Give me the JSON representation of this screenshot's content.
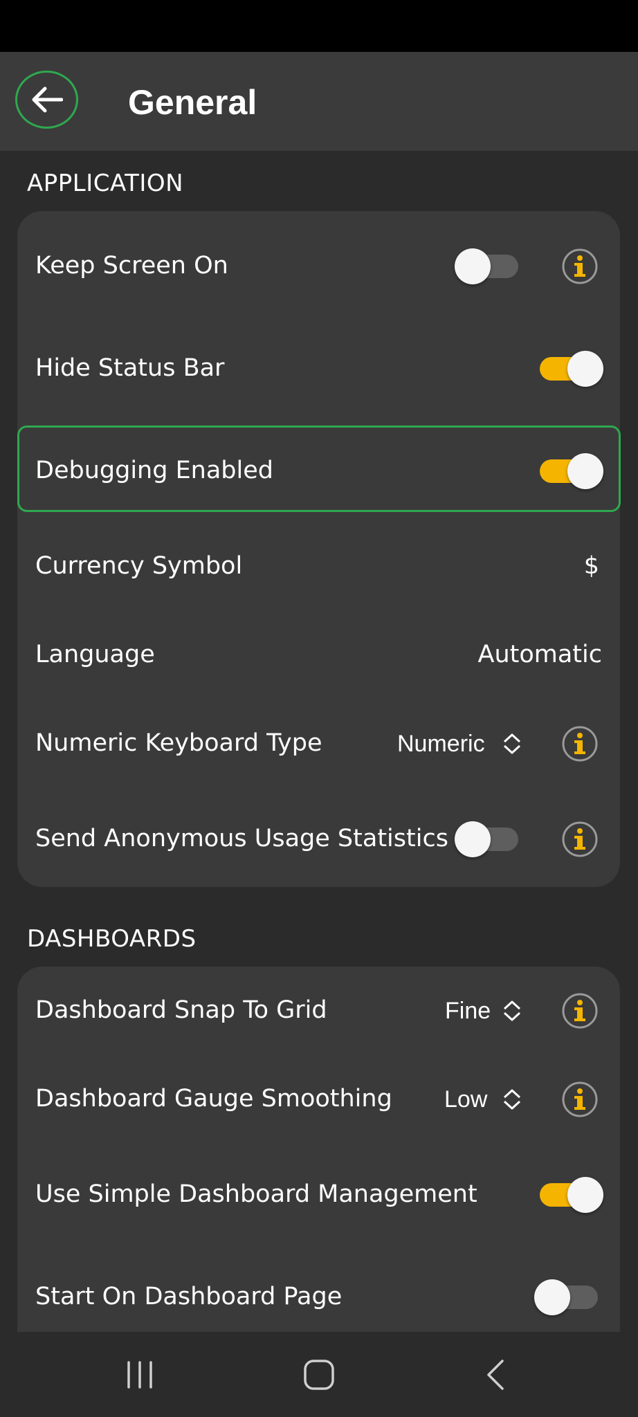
{
  "header": {
    "title": "General"
  },
  "sections": {
    "application": {
      "title": "APPLICATION",
      "rows": {
        "keep_screen_on": {
          "label": "Keep Screen On",
          "toggle": "off"
        },
        "hide_status_bar": {
          "label": "Hide Status Bar",
          "toggle": "on"
        },
        "debugging_enabled": {
          "label": "Debugging Enabled",
          "toggle": "on"
        },
        "currency_symbol": {
          "label": "Currency Symbol",
          "value": "$"
        },
        "language": {
          "label": "Language",
          "value": "Automatic"
        },
        "numeric_keyboard_type": {
          "label": "Numeric Keyboard Type",
          "value": "Numeric"
        },
        "send_usage_stats": {
          "label": "Send Anonymous Usage Statistics",
          "toggle": "off"
        }
      }
    },
    "dashboards": {
      "title": "DASHBOARDS",
      "rows": {
        "snap_to_grid": {
          "label": "Dashboard Snap To Grid",
          "value": "Fine"
        },
        "gauge_smoothing": {
          "label": "Dashboard Gauge Smoothing",
          "value": "Low"
        },
        "simple_management": {
          "label": "Use Simple Dashboard Management",
          "toggle": "on"
        },
        "start_on_dashboard": {
          "label": "Start On Dashboard Page",
          "toggle": "off"
        }
      }
    }
  },
  "colors": {
    "accent": "#f4b400",
    "highlight": "#2fa84f",
    "card": "#3a3a3a",
    "background": "#2b2b2b"
  },
  "icons": {
    "back": "arrow-left-icon",
    "info": "info-icon",
    "updown": "updown-chevron-icon",
    "nav_recent": "recent-apps-icon",
    "nav_home": "home-icon",
    "nav_back": "back-chevron-icon"
  }
}
